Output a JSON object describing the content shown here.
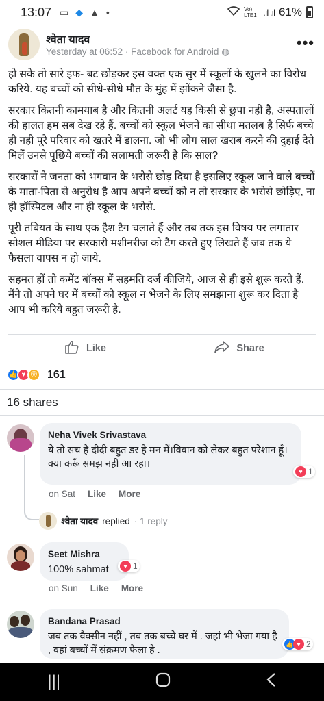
{
  "status_bar": {
    "time": "13:07",
    "icons": [
      "screen-icon",
      "app-icon",
      "notification-icon",
      "dot-icon"
    ],
    "network": "Vo) LTE1",
    "battery": "61%"
  },
  "post": {
    "author": "श्वेता यादव",
    "timestamp": "Yesterday at 06:52",
    "source": "Facebook for Android",
    "paragraphs": [
      "हो सके तो सारे इफ- बट छोड़कर इस वक्त एक सुर में स्कूलों के खुलने का विरोध करिये. यह बच्चों को सीधे-सीधे मौत के मुंह में झोंकने जैसा है.",
      "सरकार कितनी कामयाब है और कितनी अलर्ट यह किसी से छुपा नही है, अस्पतालों की हालत हम सब देख रहे हैं. बच्चों को स्कूल भेजने का सीधा मतलब है सिर्फ बच्चे ही नही पूरे परिवार को खतरे में डालना. जो भी लोग साल खराब करने की दुहाई देते मिलें उनसे पूछिये बच्चों की सलामती जरूरी है कि साल?",
      "सरकारों ने जनता को भगवान के भरोसे छोड़ दिया है इसलिए स्कूल जाने वाले बच्चों के माता-पिता से अनुरोध है आप अपने बच्चों को न तो सरकार के भरोसे छोड़िए, ना ही हॉस्पिटल और ना ही स्कूल के भरोसे.",
      "पूरी तबियत के साथ एक हैश टैग चलाते हैं और तब तक इस विषय पर लगातार सोशल मीडिया पर सरकारी मशीनरीज को टैग करते हुए लिखते हैं जब तक ये फैसला वापस न हो जाये.",
      "सहमत हों तो कमेंट बॉक्स में सहमति दर्ज कीजिये, आज से ही इसे शुरू करते हैं. मैंने तो अपने घर में बच्चों को स्कूल न भेजने के लिए समझाना शुरू कर दिता है आप भी करिये बहुत जरूरी है."
    ],
    "like_label": "Like",
    "share_label": "Share",
    "reaction_count": "161",
    "shares_text": "16 shares"
  },
  "comments": [
    {
      "name": "Neha Vivek Srivastava",
      "text_lines": [
        "ये तो सच है दीदी बहुत डर है मन में।विवान को लेकर बहुत परेशान हूँ।",
        "क्या करूँ समझ नही आ रहा।"
      ],
      "time": "on Sat",
      "like": "Like",
      "more": "More",
      "reaction_count": "1"
    },
    {
      "name": "Seet Mishra",
      "text_lines": [
        "100% sahmat"
      ],
      "time": "on Sun",
      "like": "Like",
      "more": "More",
      "reaction_count": "1"
    },
    {
      "name": "Bandana Prasad",
      "text_lines": [
        "जब तक वैक्सीन नहीं , तब तक बच्चे घर में . जहां भी भेजा गया है , वहां बच्चों में संक्रमण फैला है ."
      ],
      "reaction_count": "2"
    }
  ],
  "reply_summary": {
    "name": "श्वेता यादव",
    "action": "replied",
    "count": "· 1 reply"
  },
  "colors": {
    "link_blue": "#1877f2",
    "love_red": "#f33e58",
    "bubble_bg": "#f0f2f5",
    "meta_gray": "#8a8d91"
  }
}
